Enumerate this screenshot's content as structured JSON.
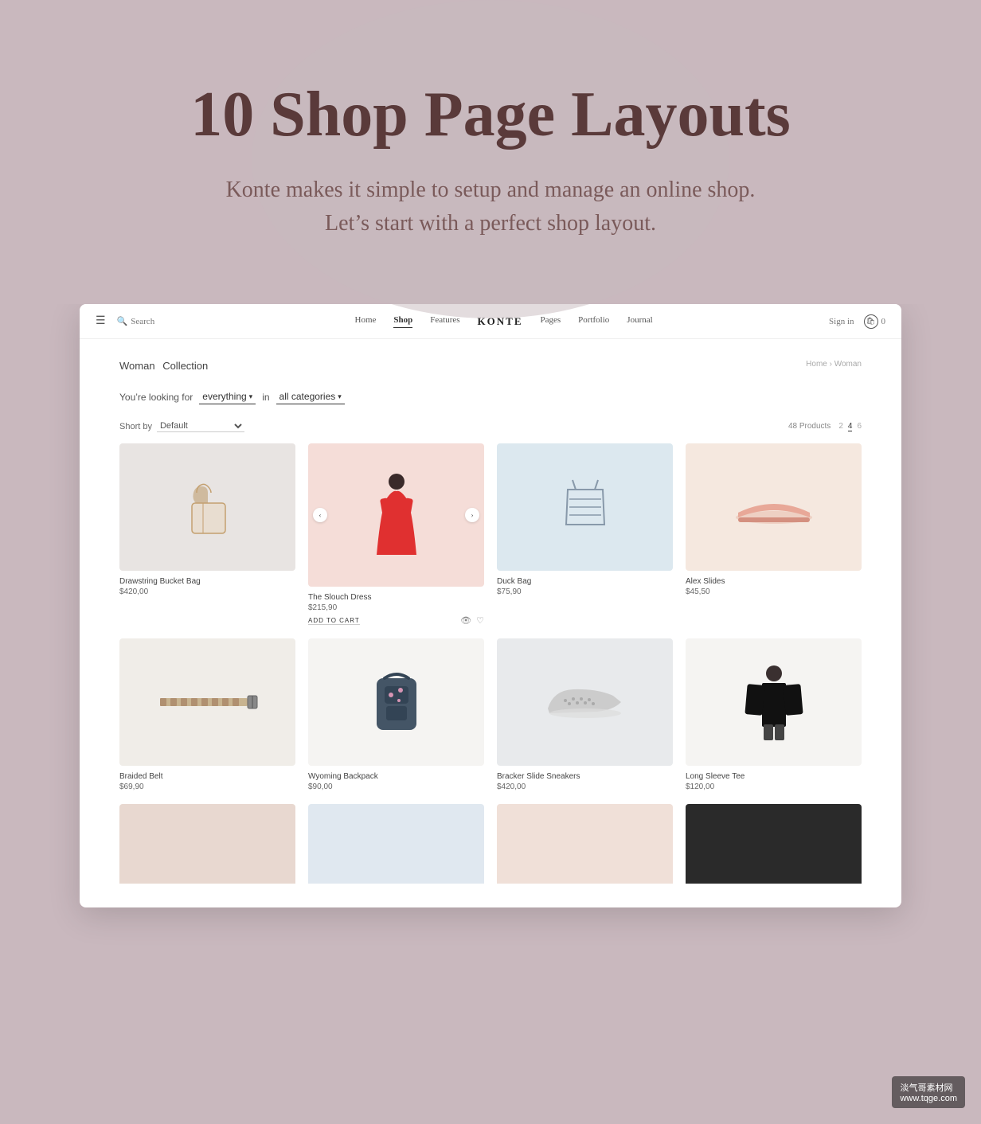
{
  "hero": {
    "title": "10 Shop Page Layouts",
    "subtitle_line1": "Konte makes it simple to setup and manage an online shop.",
    "subtitle_line2": "Let’s start with a perfect shop layout."
  },
  "nav": {
    "links": [
      "Home",
      "Shop",
      "Features",
      "KONTE",
      "Pages",
      "Portfolio",
      "Journal"
    ],
    "active_link": "Shop",
    "search_label": "Search",
    "sign_in_label": "Sign in",
    "cart_count": "0"
  },
  "shop": {
    "collection_title": "Woman",
    "collection_subtitle": "Collection",
    "breadcrumb": "Home › Woman",
    "filter_label": "You’re looking for",
    "filter_keyword": "everything",
    "filter_in": "in",
    "filter_category": "all categories",
    "sort_label": "Short by",
    "products_count": "48 Products",
    "grid_options": [
      "2",
      "4",
      "6"
    ],
    "active_grid": "4"
  },
  "products": [
    {
      "id": 1,
      "name": "Drawstring Bucket Bag",
      "price": "$420,00",
      "bg": "bg-gray",
      "shape": "bag"
    },
    {
      "id": 2,
      "name": "The Slouch Dress",
      "price": "$215,90",
      "bg": "bg-pink",
      "shape": "dress",
      "has_actions": true,
      "add_to_cart": "ADD TO CART"
    },
    {
      "id": 3,
      "name": "Duck Bag",
      "price": "$75,90",
      "bg": "bg-blue",
      "shape": "tote"
    },
    {
      "id": 4,
      "name": "Alex Slides",
      "price": "$45,50",
      "bg": "bg-peach",
      "shape": "slide"
    },
    {
      "id": 5,
      "name": "Braided Belt",
      "price": "$69,90",
      "bg": "bg-cream",
      "shape": "belt"
    },
    {
      "id": 6,
      "name": "Wyoming Backpack",
      "price": "$90,00",
      "bg": "bg-white",
      "shape": "backpack"
    },
    {
      "id": 7,
      "name": "Bracker Slide Sneakers",
      "price": "$420,00",
      "bg": "bg-lightgray",
      "shape": "sneaker"
    },
    {
      "id": 8,
      "name": "Long Sleeve Tee",
      "price": "$120,00",
      "bg": "bg-white",
      "shape": "longsleeve"
    }
  ],
  "watermark": {
    "line1": "淡气哥素材网",
    "line2": "www.tqge.com"
  }
}
